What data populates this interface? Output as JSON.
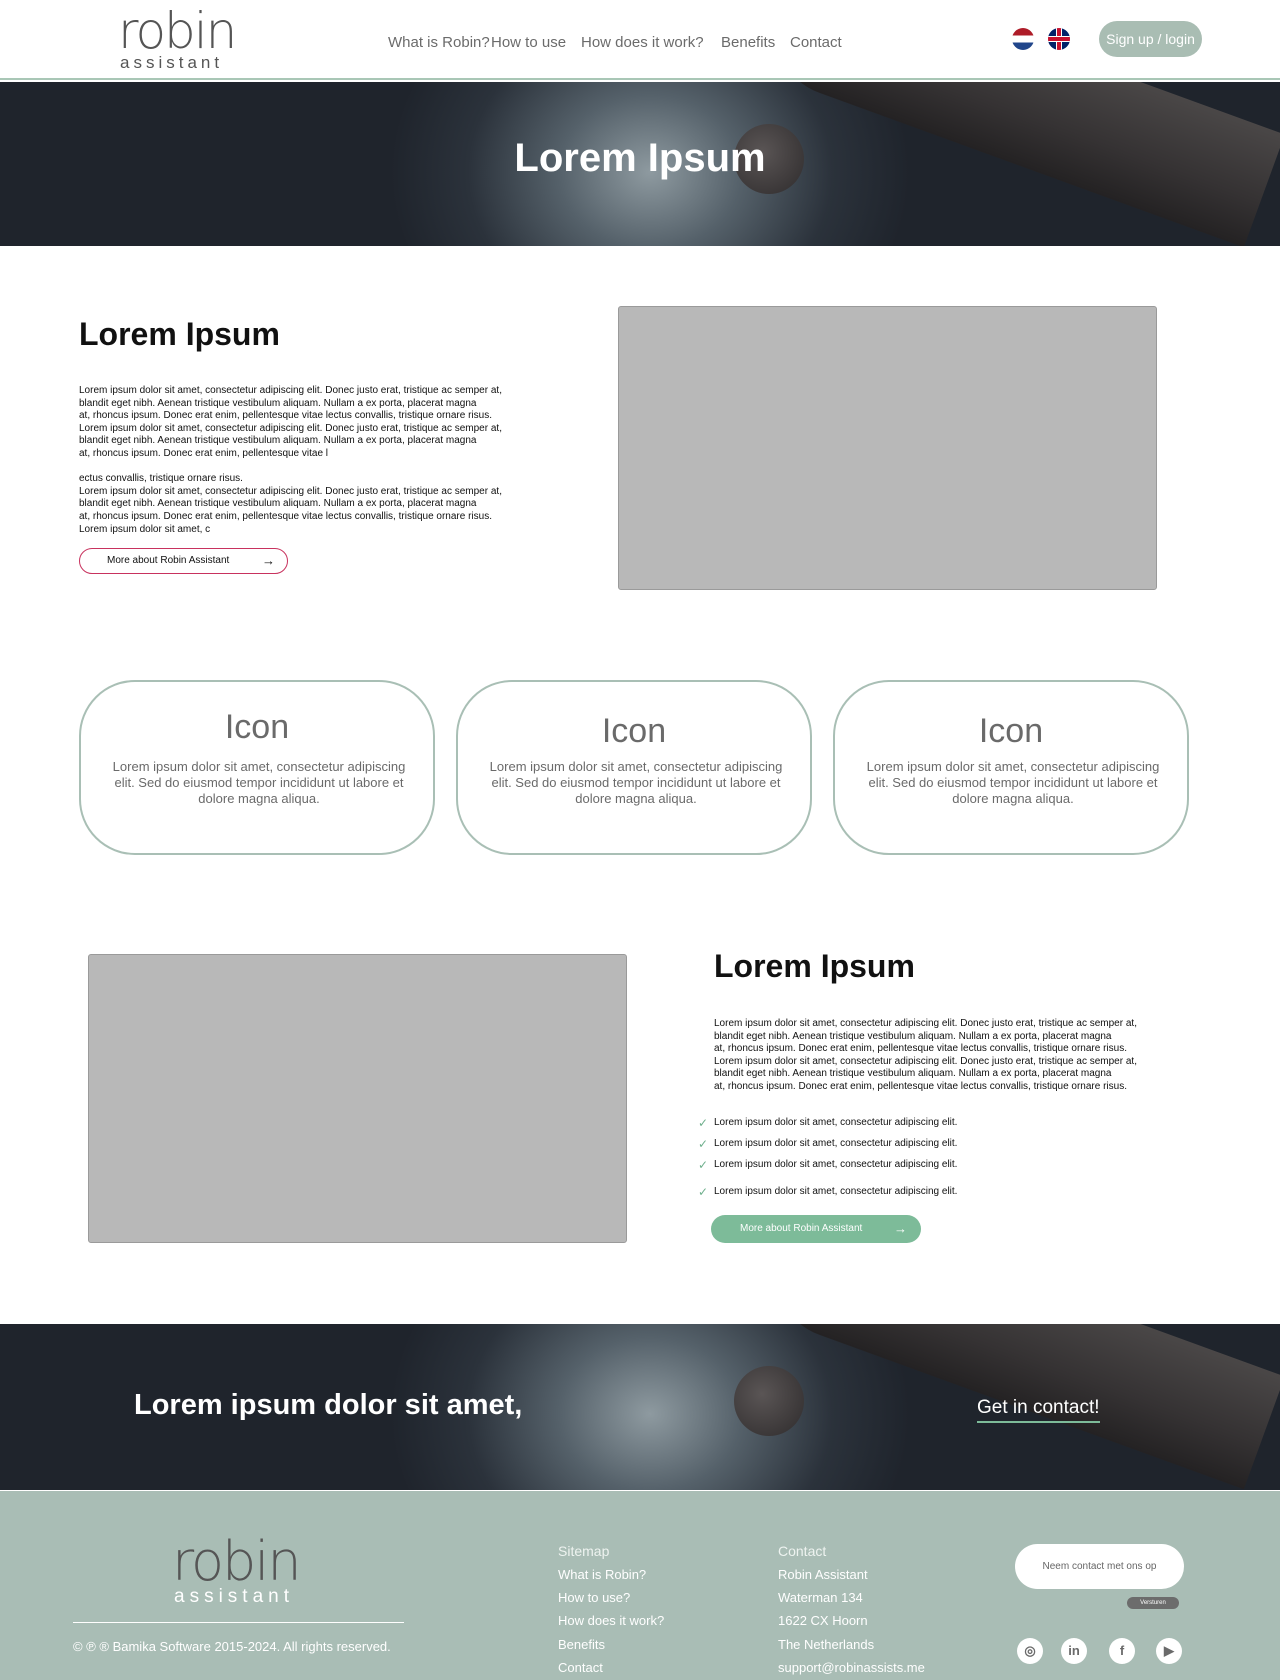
{
  "header": {
    "logo_word": "robin",
    "logo_sub": "assistant",
    "nav": [
      "What is Robin?",
      "How to use",
      "How does it work?",
      "Benefits",
      "Contact"
    ],
    "signup_label": "Sign up / login"
  },
  "hero": {
    "title": "Lorem Ipsum"
  },
  "section1": {
    "title": "Lorem Ipsum",
    "paragraph": "Lorem ipsum dolor sit amet, consectetur adipiscing elit. Donec justo erat, tristique ac semper at,\nblandit eget nibh. Aenean tristique vestibulum aliquam. Nullam a ex porta, placerat magna\nat, rhoncus ipsum. Donec erat enim, pellentesque vitae lectus convallis, tristique ornare risus.\nLorem ipsum dolor sit amet, consectetur adipiscing elit. Donec justo erat, tristique ac semper at,\nblandit eget nibh. Aenean tristique vestibulum aliquam. Nullam a ex porta, placerat magna\nat, rhoncus ipsum. Donec erat enim, pellentesque vitae l\n\nectus convallis, tristique ornare risus.\nLorem ipsum dolor sit amet, consectetur adipiscing elit. Donec justo erat, tristique ac semper at,\nblandit eget nibh. Aenean tristique vestibulum aliquam. Nullam a ex porta, placerat magna\nat, rhoncus ipsum. Donec erat enim, pellentesque vitae lectus convallis, tristique ornare risus.\nLorem ipsum dolor sit amet, c",
    "button_label": "More about Robin Assistant"
  },
  "cards": [
    {
      "icon": "Icon",
      "text": "Lorem ipsum dolor sit amet, consectetur adipiscing elit. Sed do eiusmod tempor incididunt ut labore et dolore magna aliqua."
    },
    {
      "icon": "Icon",
      "text": "Lorem ipsum dolor sit amet, consectetur adipiscing elit. Sed do eiusmod tempor incididunt ut labore et dolore magna aliqua."
    },
    {
      "icon": "Icon",
      "text": "Lorem ipsum dolor sit amet, consectetur adipiscing elit. Sed do eiusmod tempor incididunt ut labore et dolore magna aliqua."
    }
  ],
  "section2": {
    "title": "Lorem Ipsum",
    "paragraph": "Lorem ipsum dolor sit amet, consectetur adipiscing elit. Donec justo erat, tristique ac semper at,\nblandit eget nibh. Aenean tristique vestibulum aliquam. Nullam a ex porta, placerat magna\nat, rhoncus ipsum. Donec erat enim, pellentesque vitae lectus convallis, tristique ornare risus.\nLorem ipsum dolor sit amet, consectetur adipiscing elit. Donec justo erat, tristique ac semper at,\nblandit eget nibh. Aenean tristique vestibulum aliquam. Nullam a ex porta, placerat magna\nat, rhoncus ipsum. Donec erat enim, pellentesque vitae lectus convallis, tristique ornare risus.",
    "checklist": [
      "Lorem ipsum dolor sit amet, consectetur adipiscing elit.",
      "Lorem ipsum dolor sit amet, consectetur adipiscing elit.",
      "Lorem ipsum dolor sit amet, consectetur adipiscing elit.",
      "Lorem ipsum dolor sit amet, consectetur adipiscing elit."
    ],
    "button_label": "More about Robin Assistant"
  },
  "cta": {
    "text": "Lorem ipsum dolor sit amet,",
    "link": "Get in contact!"
  },
  "footer": {
    "logo_word": "robin",
    "logo_sub": "assistant",
    "copyright": "© ℗ ® Bamika Software 2015-2024. All rights reserved.",
    "sitemap_title": "Sitemap",
    "sitemap": [
      "What is Robin?",
      "How to use?",
      "How does it work?",
      "Benefits",
      "Contact"
    ],
    "contact_title": "Contact",
    "contact": [
      "Robin Assistant",
      "Waterman 134",
      "1622 CX Hoorn",
      "The Netherlands",
      "support@robinassists.me"
    ],
    "contact_placeholder": "Neem contact met ons op",
    "send_label": "Versturen"
  },
  "icons": {
    "arrow": "arrow-right-icon",
    "check": "check-icon",
    "flags": [
      "flag-nl-icon",
      "flag-uk-icon"
    ],
    "social": [
      "instagram-icon",
      "linkedin-icon",
      "facebook-icon",
      "youtube-icon"
    ]
  },
  "colors": {
    "accent_green": "#7dbb99",
    "footer_bg": "#a9bdb5",
    "outline_button": "#c8325e",
    "signup_bg": "#a9bdb3"
  }
}
